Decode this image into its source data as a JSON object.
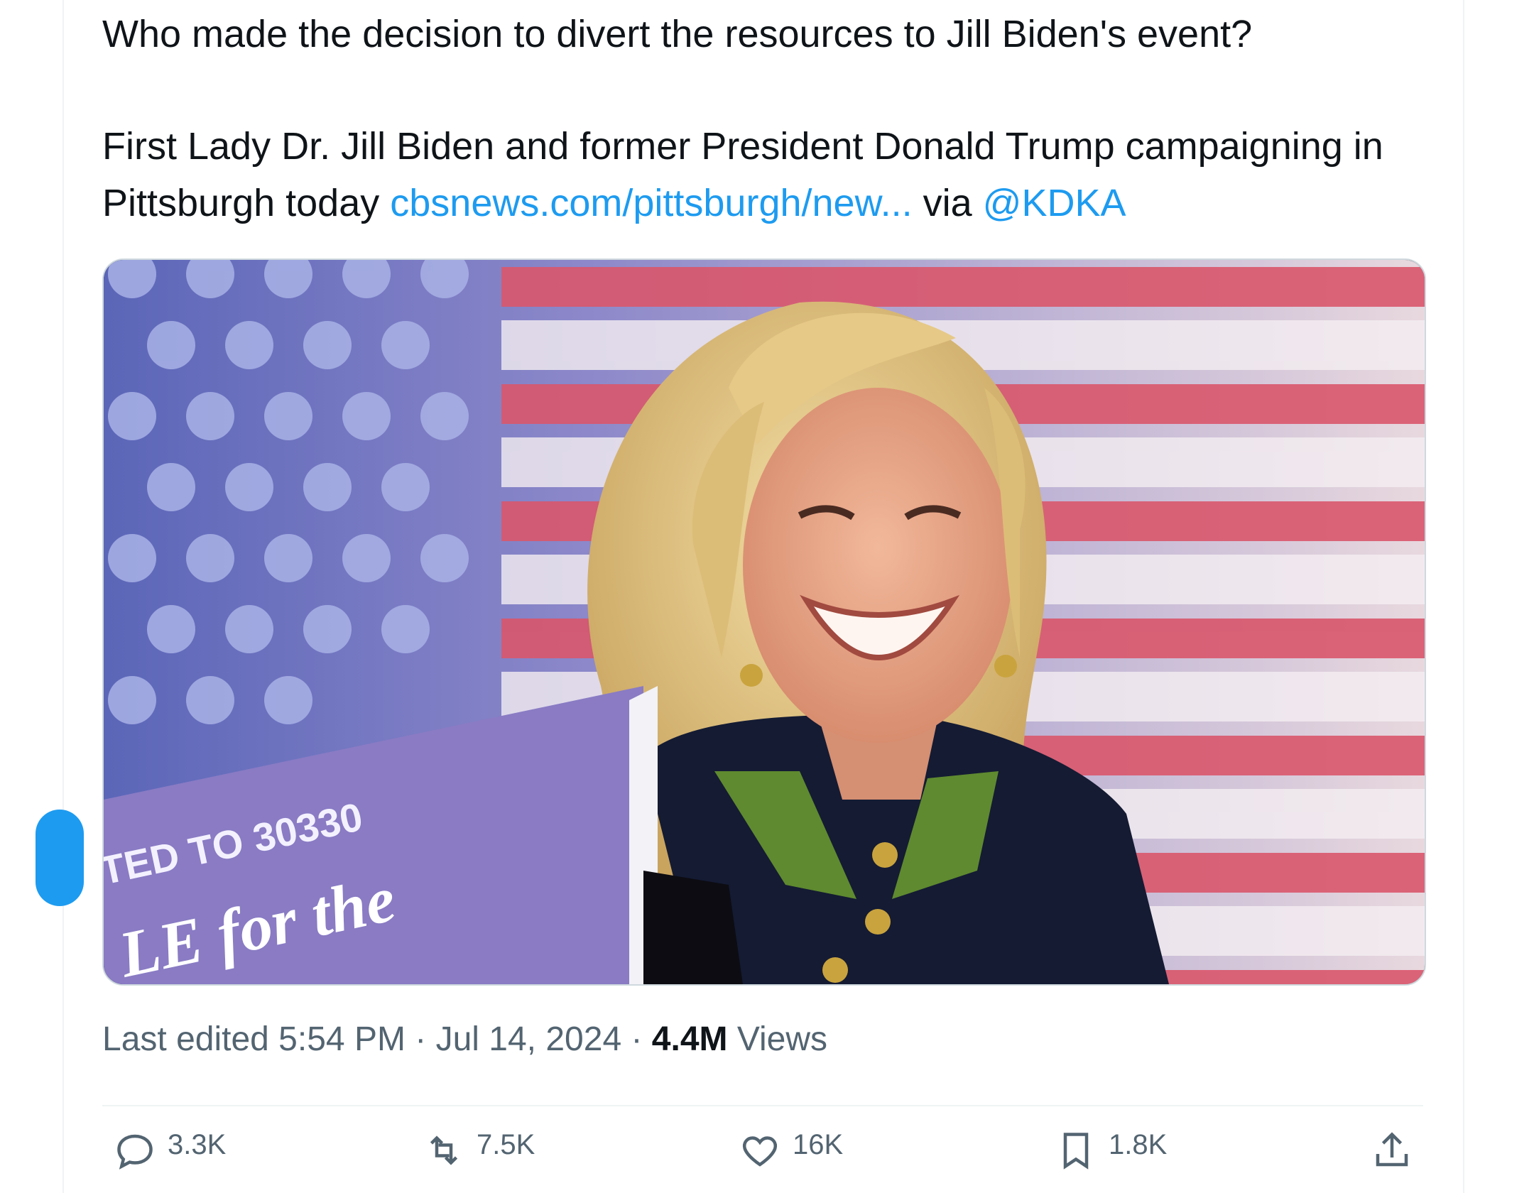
{
  "tweet": {
    "line1": "Who made the decision to divert the resources to Jill Biden's event?",
    "body_prefix": "First Lady Dr. Jill Biden and former President Donald Trump campaigning in Pittsburgh today ",
    "link_text": "cbsnews.com/pittsburgh/new...",
    "via_text": " via ",
    "mention": "@KDKA"
  },
  "media": {
    "sign_line1": "TED TO 30330",
    "sign_line2": "LE for the"
  },
  "meta": {
    "edited_label": "Last edited 5:54 PM · Jul 14, 2024 · ",
    "views_count": "4.4M",
    "views_label": " Views"
  },
  "actions": {
    "reply_count": "3.3K",
    "retweet_count": "7.5K",
    "like_count": "16K",
    "bookmark_count": "1.8K"
  },
  "colors": {
    "accent": "#1d9bf0",
    "text": "#0f1419",
    "muted": "#536471",
    "border": "#eff3f4"
  }
}
